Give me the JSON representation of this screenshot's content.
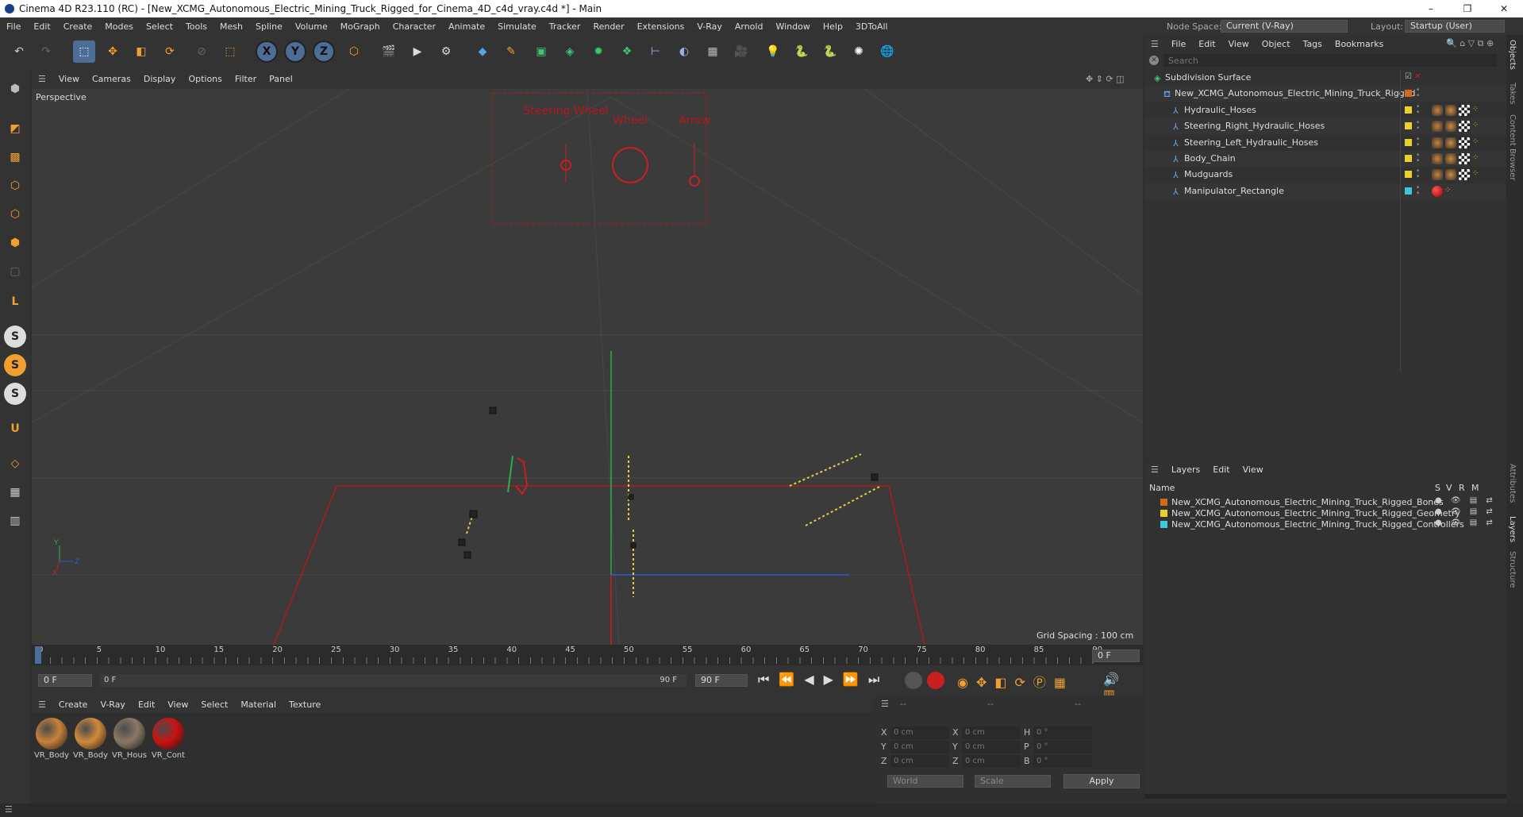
{
  "window": {
    "title": "Cinema 4D R23.110 (RC) - [New_XCMG_Autonomous_Electric_Mining_Truck_Rigged_for_Cinema_4D_c4d_vray.c4d *] - Main",
    "min": "–",
    "max": "❐",
    "close": "✕"
  },
  "menu": [
    "File",
    "Edit",
    "Create",
    "Modes",
    "Select",
    "Tools",
    "Mesh",
    "Spline",
    "Volume",
    "MoGraph",
    "Character",
    "Animate",
    "Simulate",
    "Tracker",
    "Render",
    "Extensions",
    "V-Ray",
    "Arnold",
    "Window",
    "Help",
    "3DToAll"
  ],
  "node_space": {
    "label": "Node Space:",
    "value": "Current (V-Ray)"
  },
  "layout": {
    "label": "Layout:",
    "value": "Startup (User)"
  },
  "viewport": {
    "menu": [
      "View",
      "Cameras",
      "Display",
      "Options",
      "Filter",
      "Panel"
    ],
    "name": "Perspective",
    "grid_spacing": "Grid Spacing : 100 cm",
    "labels": {
      "steering": "Steering Wheel",
      "wheel": "Wheel",
      "arrow": "Arrow"
    }
  },
  "timeline": {
    "ticks": [
      "0",
      "5",
      "10",
      "15",
      "20",
      "25",
      "30",
      "35",
      "40",
      "45",
      "50",
      "55",
      "60",
      "65",
      "70",
      "75",
      "80",
      "85",
      "90"
    ],
    "current_frame": "0 F",
    "start": "0 F",
    "range_start": "0 F",
    "range_end": "90 F",
    "end": "90 F"
  },
  "material_manager": {
    "menu": [
      "Create",
      "V-Ray",
      "Edit",
      "View",
      "Select",
      "Material",
      "Texture"
    ],
    "materials": [
      {
        "name": "VR_Body",
        "color": "#c8823a"
      },
      {
        "name": "VR_Body",
        "color": "#d28a3c"
      },
      {
        "name": "VR_Hous",
        "color": "#8a7866"
      },
      {
        "name": "VR_Cont",
        "color": "#cc1111"
      }
    ]
  },
  "coords": {
    "headers": [
      "--",
      "--",
      "--"
    ],
    "rows": [
      {
        "a": "X",
        "av": "0 cm",
        "b": "X",
        "bv": "0 cm",
        "c": "H",
        "cv": "0 °"
      },
      {
        "a": "Y",
        "av": "0 cm",
        "b": "Y",
        "bv": "0 cm",
        "c": "P",
        "cv": "0 °"
      },
      {
        "a": "Z",
        "av": "0 cm",
        "b": "Z",
        "bv": "0 cm",
        "c": "B",
        "cv": "0 °"
      }
    ],
    "world": "World",
    "scale": "Scale",
    "apply": "Apply"
  },
  "object_manager": {
    "menu": [
      "File",
      "Edit",
      "View",
      "Object",
      "Tags",
      "Bookmarks"
    ],
    "search_placeholder": "Search",
    "objects": [
      {
        "name": "Subdivision Surface",
        "indent": 0,
        "dot": ""
      },
      {
        "name": "New_XCMG_Autonomous_Electric_Mining_Truck_Rigged",
        "indent": 1,
        "dot": "#d2691e"
      },
      {
        "name": "Hydraulic_Hoses",
        "indent": 2,
        "dot": "#e8d22a"
      },
      {
        "name": "Steering_Right_Hydraulic_Hoses",
        "indent": 2,
        "dot": "#e8d22a"
      },
      {
        "name": "Steering_Left_Hydraulic_Hoses",
        "indent": 2,
        "dot": "#e8d22a"
      },
      {
        "name": "Body_Chain",
        "indent": 2,
        "dot": "#e8d22a"
      },
      {
        "name": "Mudguards",
        "indent": 2,
        "dot": "#e8d22a"
      },
      {
        "name": "Manipulator_Rectangle",
        "indent": 2,
        "dot": "#3cc8dc"
      }
    ]
  },
  "layer_manager": {
    "menu": [
      "Layers",
      "Edit",
      "View"
    ],
    "header": {
      "name": "Name",
      "s": "S",
      "v": "V",
      "r": "R",
      "m": "M"
    },
    "layers": [
      {
        "name": "New_XCMG_Autonomous_Electric_Mining_Truck_Rigged_Bones",
        "color": "#d2691e"
      },
      {
        "name": "New_XCMG_Autonomous_Electric_Mining_Truck_Rigged_Geometry",
        "color": "#e8d22a"
      },
      {
        "name": "New_XCMG_Autonomous_Electric_Mining_Truck_Rigged_Controllers",
        "color": "#3cc8dc"
      }
    ]
  },
  "side_tabs": [
    "Objects",
    "Takes",
    "Content Browser",
    "Attributes",
    "Layers",
    "Structure"
  ]
}
